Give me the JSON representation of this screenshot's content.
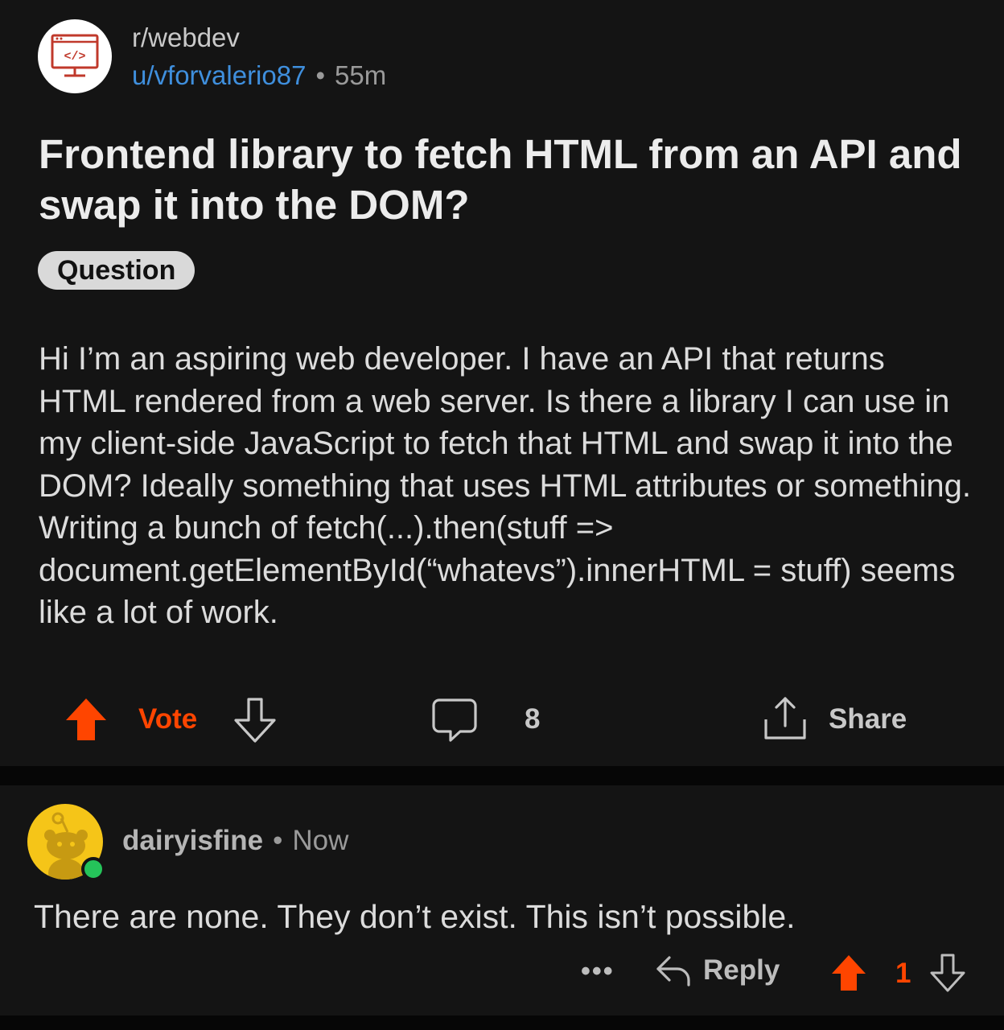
{
  "post": {
    "subreddit": "r/webdev",
    "author": "u/vforvalerio87",
    "separator": "•",
    "age": "55m",
    "title": "Frontend library to fetch HTML from an API and swap it into the DOM?",
    "flair": "Question",
    "body": "Hi I’m an aspiring web developer. I have an API that returns HTML rendered from a web server. Is there a library I can use in my client-side JavaScript to fetch that HTML and swap it into the DOM? Ideally something that uses HTML attributes or something. Writing a bunch of fetch(...).then(stuff => document.getElementById(“whatevs”).innerHTML = stuff) seems like a lot of work.",
    "vote_label": "Vote",
    "comment_count": "8",
    "share_label": "Share",
    "icons": {
      "subreddit_avatar": "code-monitor-icon",
      "upvote": "upvote-arrow-icon",
      "downvote": "downvote-arrow-icon",
      "comments": "comment-bubble-icon",
      "share": "share-icon"
    }
  },
  "comment": {
    "username": "dairyisfine",
    "separator": "•",
    "time": "Now",
    "text": "There are none. They don’t exist. This isn’t possible.",
    "more_label": "•••",
    "reply_label": "Reply",
    "score": "1",
    "icons": {
      "avatar": "snoo-avatar-icon",
      "online": "online-status-icon",
      "reply": "reply-arrow-icon",
      "upvote": "upvote-arrow-icon",
      "downvote": "downvote-arrow-icon"
    }
  },
  "colors": {
    "background": "#141414",
    "accent_orange": "#ff4500",
    "link_blue": "#3f8fdd",
    "online_green": "#25c45a",
    "avatar_yellow": "#f5c518"
  }
}
